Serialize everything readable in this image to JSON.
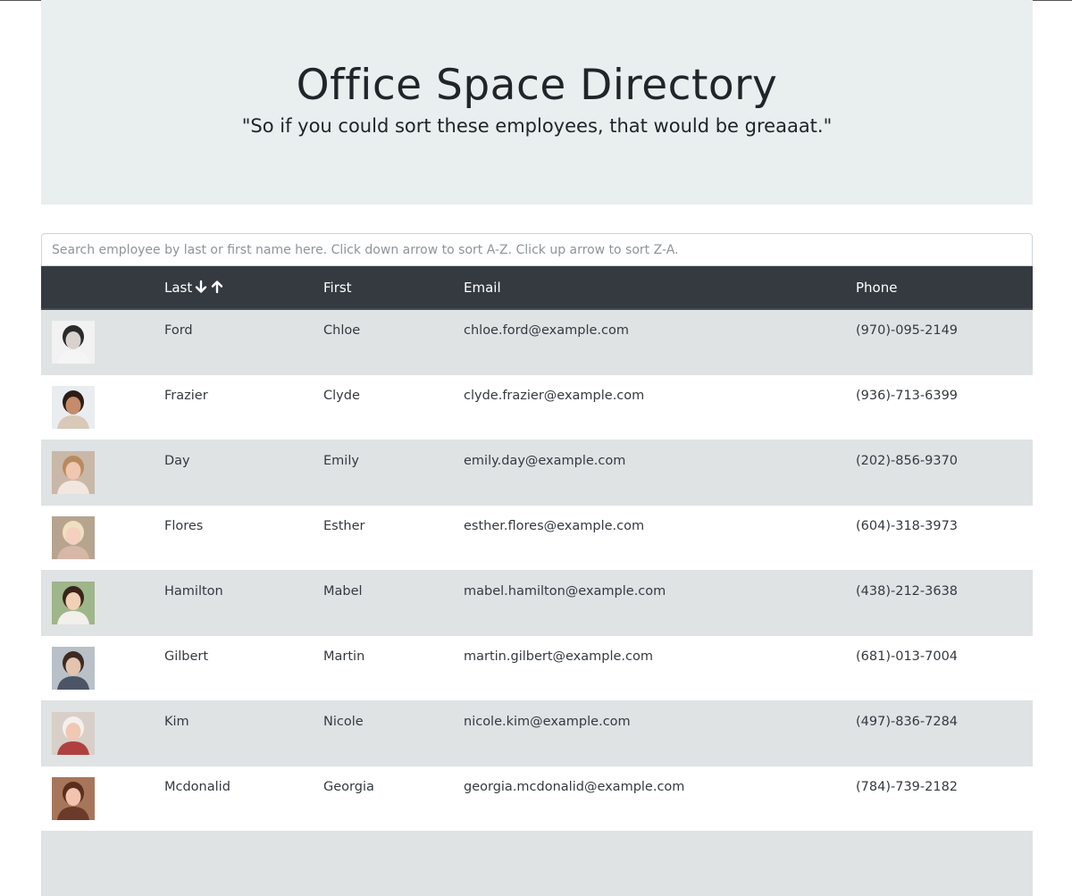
{
  "header": {
    "title": "Office Space Directory",
    "subtitle": "\"So if you could sort these employees, that would be greaaat.\""
  },
  "search": {
    "placeholder": "Search employee by last or first name here. Click down arrow to sort A-Z. Click up arrow to sort Z-A.",
    "value": ""
  },
  "table": {
    "columns": {
      "image": "",
      "last": "Last",
      "first": "First",
      "email": "Email",
      "phone": "Phone"
    },
    "sort_icons": [
      "arrow-down-icon",
      "arrow-up-icon"
    ],
    "rows": [
      {
        "last": "Ford",
        "first": "Chloe",
        "email": "chloe.ford@example.com",
        "phone": "(970)-095-2149",
        "avatar": {
          "bg": "#f2f2f2",
          "skin": "#d8d2cf",
          "hair": "#2a2a2a",
          "shirt": "#f5f5f5"
        }
      },
      {
        "last": "Frazier",
        "first": "Clyde",
        "email": "clyde.frazier@example.com",
        "phone": "(936)-713-6399",
        "avatar": {
          "bg": "#e9edf0",
          "skin": "#c58b6a",
          "hair": "#2b1d16",
          "shirt": "#d8c9b8"
        }
      },
      {
        "last": "Day",
        "first": "Emily",
        "email": "emily.day@example.com",
        "phone": "(202)-856-9370",
        "avatar": {
          "bg": "#c9b8a8",
          "skin": "#f0c7b0",
          "hair": "#b98a5e",
          "shirt": "#f3e6e0"
        }
      },
      {
        "last": "Flores",
        "first": "Esther",
        "email": "esther.flores@example.com",
        "phone": "(604)-318-3973",
        "avatar": {
          "bg": "#b7a48e",
          "skin": "#f3d0c0",
          "hair": "#efe0c0",
          "shirt": "#d6b7a8"
        }
      },
      {
        "last": "Hamilton",
        "first": "Mabel",
        "email": "mabel.hamilton@example.com",
        "phone": "(438)-212-3638",
        "avatar": {
          "bg": "#9fb58a",
          "skin": "#f1d1b5",
          "hair": "#3a2419",
          "shirt": "#f2f0ea"
        }
      },
      {
        "last": "Gilbert",
        "first": "Martin",
        "email": "martin.gilbert@example.com",
        "phone": "(681)-013-7004",
        "avatar": {
          "bg": "#b9c0c8",
          "skin": "#e3c4ae",
          "hair": "#3b2b22",
          "shirt": "#4b5566"
        }
      },
      {
        "last": "Kim",
        "first": "Nicole",
        "email": "nicole.kim@example.com",
        "phone": "(497)-836-7284",
        "avatar": {
          "bg": "#d8cfc8",
          "skin": "#f0c8b4",
          "hair": "#f4f1ec",
          "shirt": "#b04040"
        }
      },
      {
        "last": "Mcdonalid",
        "first": "Georgia",
        "email": "georgia.mcdonalid@example.com",
        "phone": "(784)-739-2182",
        "avatar": {
          "bg": "#a7755a",
          "skin": "#f2c3ae",
          "hair": "#5a2e1c",
          "shirt": "#6a3a2a"
        }
      },
      {
        "last": "",
        "first": "",
        "email": "",
        "phone": "",
        "avatar": {
          "bg": "#dfe3e4",
          "skin": "#dfe3e4",
          "hair": "#dfe3e4",
          "shirt": "#dfe3e4"
        }
      }
    ]
  },
  "colors": {
    "jumbotron_bg": "#e9eeee",
    "header_bg": "#343a40",
    "striped_row": "#dfe3e4"
  }
}
